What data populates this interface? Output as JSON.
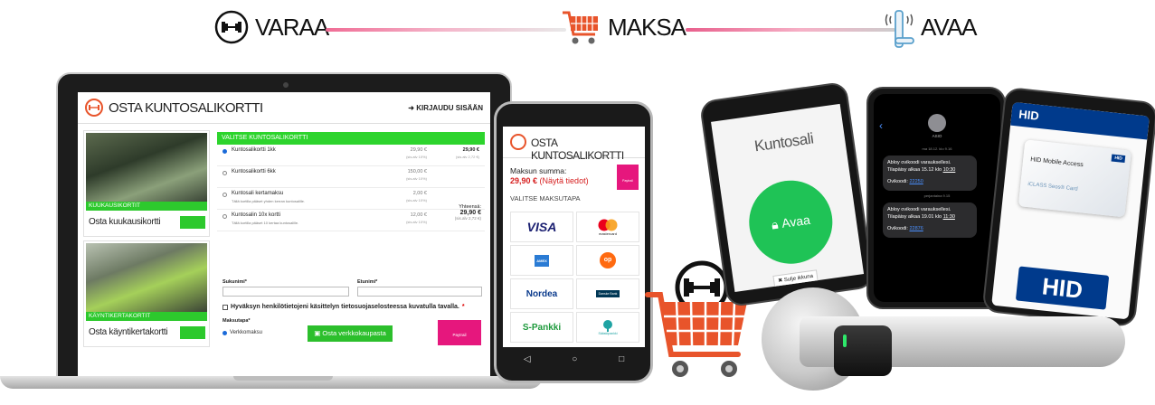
{
  "steps": [
    {
      "label": "VARAA",
      "icon": "dumbbell-icon"
    },
    {
      "label": "MAKSA",
      "icon": "shopping-cart-icon"
    },
    {
      "label": "AVAA",
      "icon": "door-handle-icon"
    }
  ],
  "laptop": {
    "header_title": "OSTA KUNTOSALIKORTTI",
    "login_label": "KIRJAUDU SISÄÄN",
    "cards": [
      {
        "band": "KUUKAUSIKORTIT",
        "name": "Osta kuukausikortti"
      },
      {
        "band": "KÄYNTIKERTAKORTIT",
        "name": "Osta käyntikertakortti"
      }
    ],
    "panel_title": "VALITSE KUNTOSALIKORTTI",
    "products": [
      {
        "name": "Kuntosalikortti 1kk",
        "desc": "",
        "price": "29,90 €",
        "alv": "(sis.alv 10%)",
        "total": "29,90 €",
        "total_alv": "(sis.alv 2,72 €)",
        "selected": true
      },
      {
        "name": "Kuntosalikortti 6kk",
        "desc": "",
        "price": "150,00 €",
        "alv": "(sis.alv 10%)",
        "total": "",
        "total_alv": "",
        "selected": false
      },
      {
        "name": "Kuntosali kertamaksu",
        "desc": "Tällä kortilla pääset yhden kerran kuntosalille.",
        "price": "2,00 €",
        "alv": "(sis.alv 10%)",
        "total": "",
        "total_alv": "",
        "selected": false
      },
      {
        "name": "Kuntosalin 10x kortti",
        "desc": "Tällä kortilla pääset 10 kertaa kuntosalille.",
        "price": "12,00 €",
        "alv": "(sis.alv 10%)",
        "total": "",
        "total_alv": "",
        "selected": false
      }
    ],
    "total_label": "Yhteensä:",
    "total_value": "29,90 €",
    "total_alv": "(sis.alv 2,72 €)",
    "surname_label": "Sukunimi*",
    "firstname_label": "Etunimi*",
    "consent_text": "Hyväksyn henkilötietojeni käsittelyn tietosuojaselosteessa kuvatulla tavalla.",
    "consent_required": "*",
    "payment_label": "Maksutapa*",
    "payment_option": "Verkkomaksu",
    "shop_button": "Osta verkkokaupasta",
    "paytrail": "Paytrail"
  },
  "phone": {
    "header_title": "OSTA KUNTOSALIKORTTI",
    "sum_label": "Maksun summa:",
    "sum_value": "29,90 €",
    "sum_link": "(Näytä tiedot)",
    "paytrail": "Paytrail",
    "method_label": "VALITSE MAKSUTAPA",
    "methods": [
      "VISA",
      "mastercard",
      "AMEX",
      "op",
      "Nordea",
      "Danske Bank",
      "S-Pankki",
      "Säästöpankki"
    ],
    "nav": [
      "◁",
      "○",
      "□"
    ]
  },
  "kuntosali_phone": {
    "title": "Kuntosali",
    "open_button": "Avaa",
    "close_link": "Sulje ikkuna"
  },
  "sms_phone": {
    "contact": "ASIO",
    "time1": "ma 18.12. klo 9.16",
    "msg1_line1": "Abloy ovikoodi varauksellesi.",
    "msg1_line2": "Tilapäisy alkaa 15.12 klo",
    "msg1_time": "10:30",
    "msg1_code_label": "Ovikoodi:",
    "msg1_code": "22250",
    "time2": "perjantaina 9.15",
    "msg2_line1": "Abloy ovikoodi varauksellesi.",
    "msg2_line2": "Tilapäisy alkaa 19.01 klo",
    "msg2_time": "11:30",
    "msg2_code_label": "Ovikoodi:",
    "msg2_code": "22876"
  },
  "hid_phone": {
    "brand": "HID",
    "card_title": "HID Mobile Access",
    "card_sub": "iCLASS Seos® Card",
    "big_logo": "HID"
  },
  "colors": {
    "accent_green": "#2dd42d",
    "accent_orange": "#e8542b",
    "paytrail_pink": "#e6177d",
    "ribbon_pink": "#f06c95",
    "price_red": "#d61e1e"
  }
}
